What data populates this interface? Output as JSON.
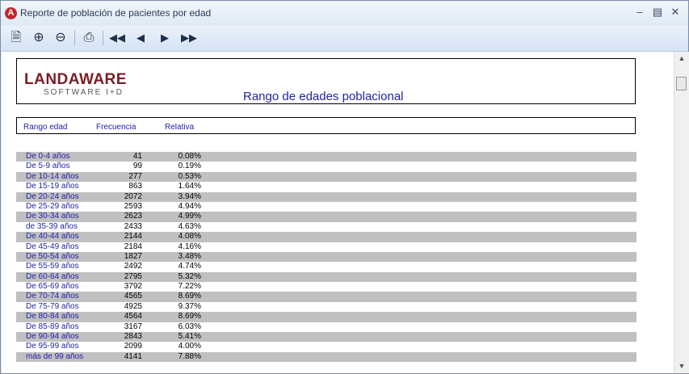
{
  "window": {
    "title": "Reporte de población de pacientes por edad"
  },
  "toolbar": {
    "buttons": [
      "preview",
      "zoom-in",
      "zoom-out",
      "print",
      "first",
      "previous",
      "next",
      "last"
    ]
  },
  "report": {
    "logo_main": "LANDAWARE",
    "logo_sub": "SOFTWARE I+D",
    "title": "Rango de edades poblacional",
    "columns": {
      "range": "Rango edad",
      "frequency": "Frecuencia",
      "relative": "Relativa"
    },
    "rows": [
      {
        "range": "De 0-4 años",
        "freq": "41",
        "rel": "0.08%"
      },
      {
        "range": "De 5-9 años",
        "freq": "99",
        "rel": "0.19%"
      },
      {
        "range": "De 10-14 años",
        "freq": "277",
        "rel": "0.53%"
      },
      {
        "range": "De 15-19 años",
        "freq": "863",
        "rel": "1.64%"
      },
      {
        "range": "De 20-24 años",
        "freq": "2072",
        "rel": "3.94%"
      },
      {
        "range": "De 25-29 años",
        "freq": "2593",
        "rel": "4.94%"
      },
      {
        "range": "De 30-34 años",
        "freq": "2623",
        "rel": "4.99%"
      },
      {
        "range": "de 35-39 años",
        "freq": "2433",
        "rel": "4.63%"
      },
      {
        "range": "De 40-44 años",
        "freq": "2144",
        "rel": "4.08%"
      },
      {
        "range": "De 45-49 años",
        "freq": "2184",
        "rel": "4.16%"
      },
      {
        "range": "De 50-54 años",
        "freq": "1827",
        "rel": "3.48%"
      },
      {
        "range": "De 55-59 años",
        "freq": "2492",
        "rel": "4.74%"
      },
      {
        "range": "De 60-64 años",
        "freq": "2795",
        "rel": "5.32%"
      },
      {
        "range": "De 65-69 años",
        "freq": "3792",
        "rel": "7.22%"
      },
      {
        "range": "De 70-74 años",
        "freq": "4565",
        "rel": "8.69%"
      },
      {
        "range": "De 75-79 años",
        "freq": "4925",
        "rel": "9.37%"
      },
      {
        "range": "De 80-84 años",
        "freq": "4564",
        "rel": "8.69%"
      },
      {
        "range": "De 85-89 años",
        "freq": "3167",
        "rel": "6.03%"
      },
      {
        "range": "De 90-94 años",
        "freq": "2843",
        "rel": "5.41%"
      },
      {
        "range": "De 95-99 años",
        "freq": "2099",
        "rel": "4.00%"
      },
      {
        "range": "más de 99 años",
        "freq": "4141",
        "rel": "7.88%"
      }
    ]
  },
  "colors": {
    "accent_text": "#2222aa",
    "row_shade": "#c0c0c0",
    "logo": "#7b1d25"
  }
}
